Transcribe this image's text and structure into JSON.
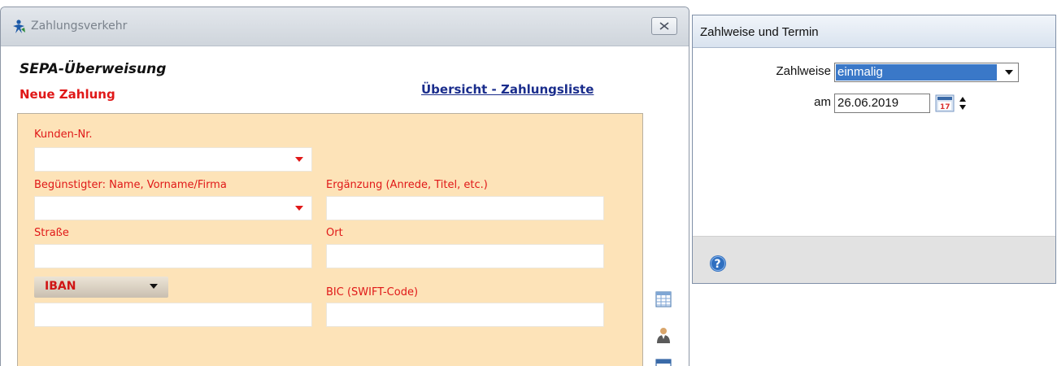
{
  "window": {
    "title": "Zahlungsverkehr"
  },
  "form": {
    "title": "SEPA-Überweisung",
    "subtitle": "Neue Zahlung",
    "overview_link": "Übersicht - Zahlungsliste",
    "fields": {
      "kunden_nr": {
        "label": "Kunden-Nr.",
        "value": ""
      },
      "beguenstigter": {
        "label": "Begünstigter: Name, Vorname/Firma",
        "value": ""
      },
      "ergaenzung": {
        "label": "Ergänzung (Anrede, Titel, etc.)",
        "value": ""
      },
      "strasse": {
        "label": "Straße",
        "value": ""
      },
      "ort": {
        "label": "Ort",
        "value": ""
      },
      "iban": {
        "selector_value": "IBAN",
        "value": ""
      },
      "bic": {
        "label": "BIC (SWIFT-Code)",
        "value": ""
      }
    }
  },
  "side_icons": [
    "table-icon",
    "person-icon",
    "calendar-icon"
  ],
  "payment_panel": {
    "title": "Zahlweise und Termin",
    "mode_label": "Zahlweise",
    "mode_value": "einmalig",
    "date_label": "am",
    "date_value": "26.06.2019"
  },
  "colors": {
    "accent_red": "#e01818",
    "link_blue": "#1a2d8c",
    "panel_bg": "#fde3b8",
    "selection_blue": "#3a78c8"
  }
}
